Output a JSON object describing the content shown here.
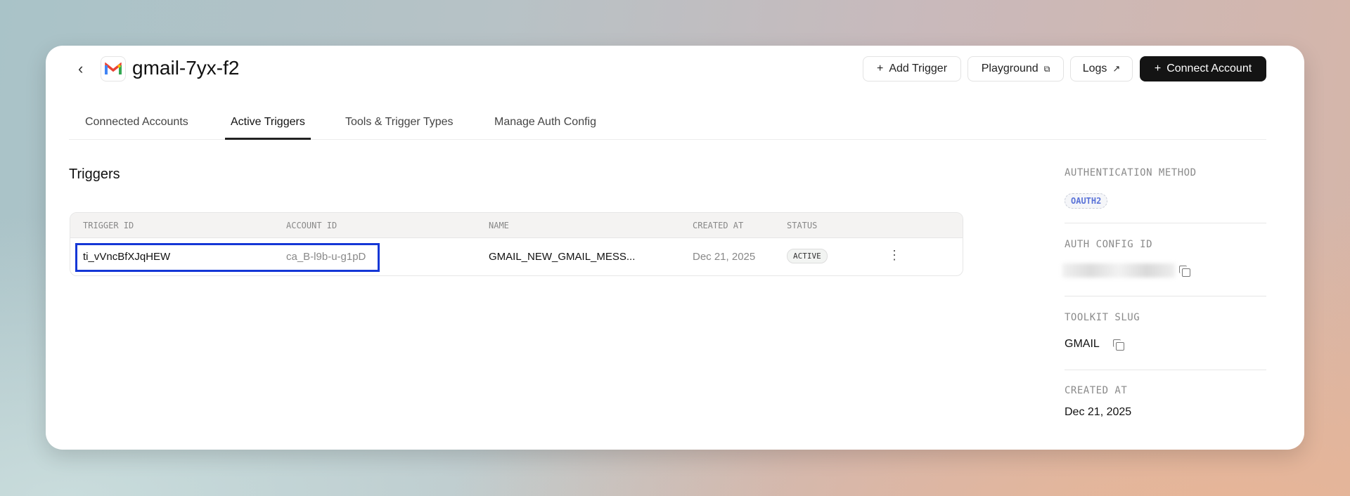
{
  "header": {
    "title": "gmail-7yx-f2",
    "back_icon": "chevron-left-icon",
    "buttons": {
      "add_trigger": "Add Trigger",
      "playground": "Playground",
      "logs": "Logs",
      "connect_account": "Connect Account"
    }
  },
  "tabs": [
    {
      "label": "Connected Accounts"
    },
    {
      "label": "Active Triggers",
      "active": true
    },
    {
      "label": "Tools & Trigger Types"
    },
    {
      "label": "Manage Auth Config"
    }
  ],
  "main": {
    "heading": "Triggers",
    "columns": [
      "TRIGGER ID",
      "ACCOUNT ID",
      "NAME",
      "CREATED AT",
      "STATUS"
    ],
    "rows": [
      {
        "trigger_id": "ti_vVncBfXJqHEW",
        "account_id": "ca_B-l9b-u-g1pD",
        "name": "GMAIL_NEW_GMAIL_MESS...",
        "created_at": "Dec 21, 2025",
        "status": "ACTIVE"
      }
    ]
  },
  "sidebar": {
    "auth_method_label": "AUTHENTICATION METHOD",
    "auth_method": "OAUTH2",
    "auth_config_label": "AUTH CONFIG ID",
    "toolkit_slug_label": "TOOLKIT SLUG",
    "toolkit_slug": "GMAIL",
    "created_at_label": "CREATED AT",
    "created_at": "Dec 21, 2025"
  },
  "colors": {
    "highlight": "#1537d6",
    "primary_button": "#141414",
    "oauth_badge": "#5a73d8"
  }
}
